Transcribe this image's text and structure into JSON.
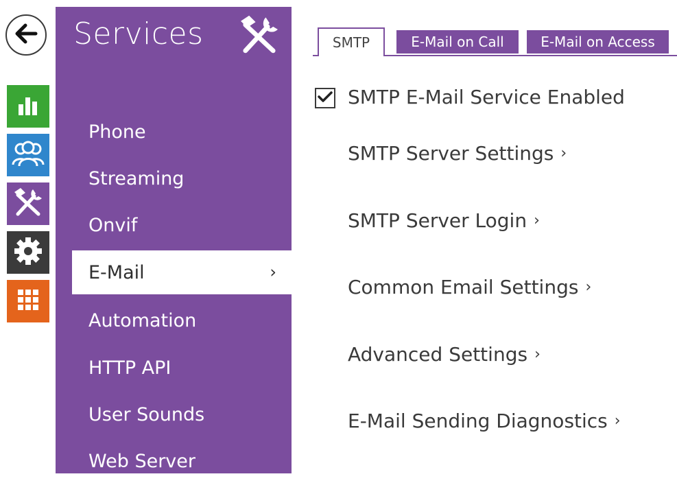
{
  "rail": {
    "back": "back-icon",
    "tiles": [
      {
        "name": "status",
        "icon": "bar-chart-icon",
        "color": "#3aa635"
      },
      {
        "name": "users",
        "icon": "users-icon",
        "color": "#2f86cc"
      },
      {
        "name": "services",
        "icon": "tools-icon",
        "color": "#7b4d9e"
      },
      {
        "name": "system",
        "icon": "gear-icon",
        "color": "#3b3b3b"
      },
      {
        "name": "apps",
        "icon": "grid-icon",
        "color": "#e4641c"
      }
    ]
  },
  "panel": {
    "title": "Services",
    "icon": "tools-icon",
    "items": [
      {
        "label": "Phone"
      },
      {
        "label": "Streaming"
      },
      {
        "label": "Onvif"
      },
      {
        "label": "E-Mail",
        "active": true
      },
      {
        "label": "Automation"
      },
      {
        "label": "HTTP API"
      },
      {
        "label": "User Sounds"
      },
      {
        "label": "Web Server"
      }
    ],
    "active_chevron": "›"
  },
  "tabs": [
    {
      "label": "SMTP",
      "active": true
    },
    {
      "label": "E-Mail on Call",
      "active": false
    },
    {
      "label": "E-Mail on Access",
      "active": false
    }
  ],
  "content": {
    "enabled": {
      "label": "SMTP E-Mail Service Enabled",
      "checked": true
    },
    "sections": [
      {
        "label": "SMTP Server Settings"
      },
      {
        "label": "SMTP Server Login"
      },
      {
        "label": "Common Email Settings"
      },
      {
        "label": "Advanced Settings"
      },
      {
        "label": "E-Mail Sending Diagnostics"
      }
    ],
    "arrow": "›"
  },
  "colors": {
    "accent": "#7b4d9e",
    "text": "#3a3a3a"
  }
}
